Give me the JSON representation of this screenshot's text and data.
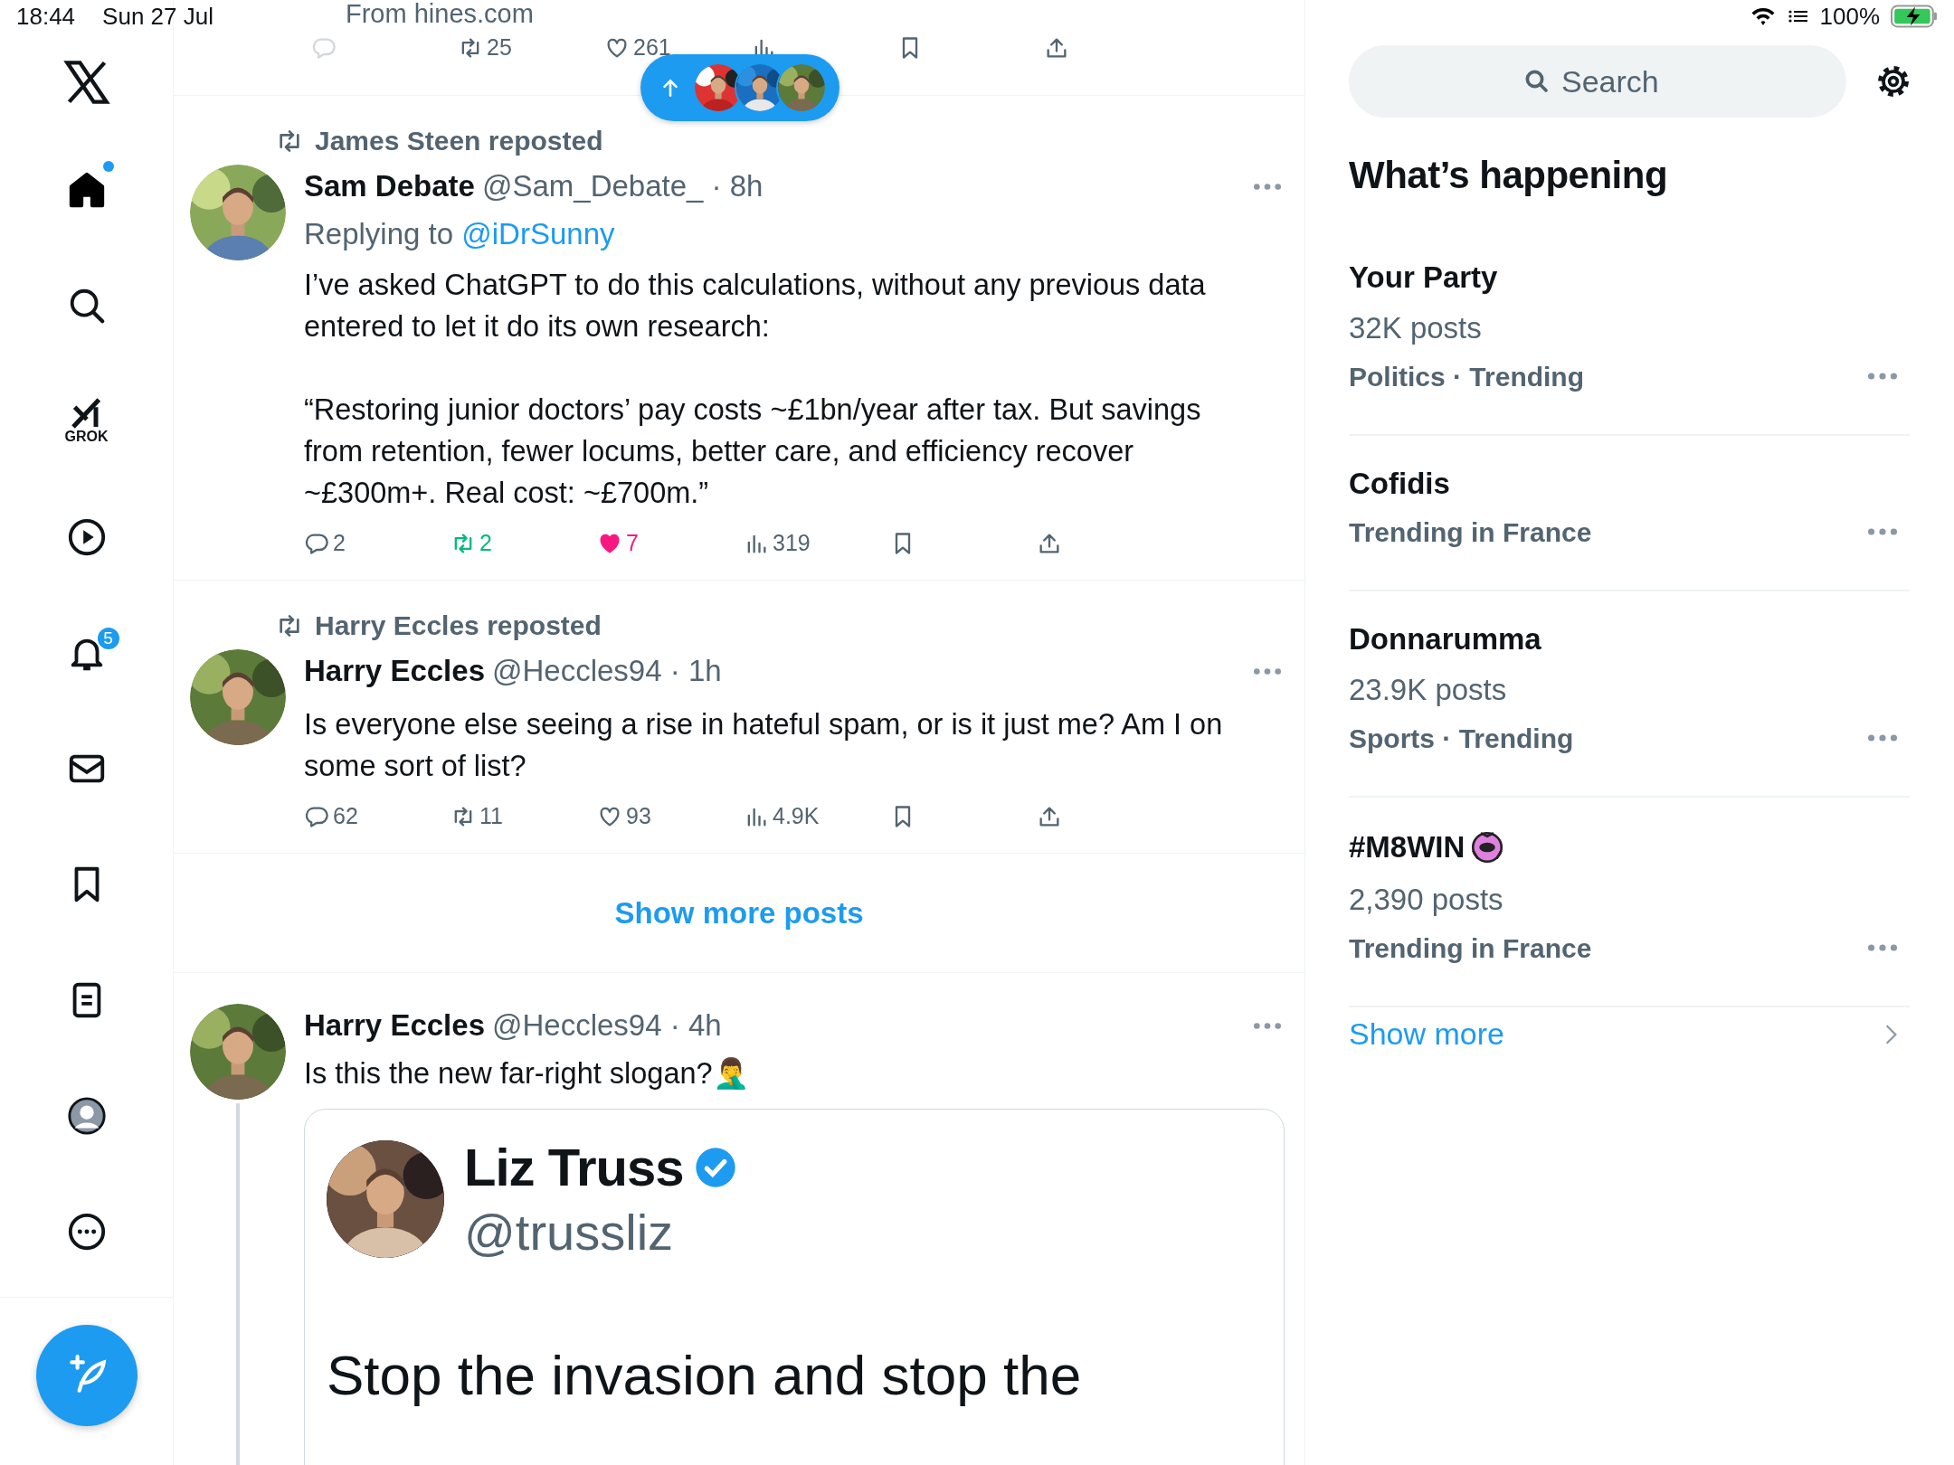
{
  "status_bar": {
    "time": "18:44",
    "date": "Sun 27 Jul",
    "battery": "100%"
  },
  "sidebar": {
    "items": [
      {
        "kind": "home",
        "selected": true,
        "dot": true
      },
      {
        "kind": "search",
        "selected": false,
        "dot": false
      },
      {
        "kind": "grok",
        "label": "GROK",
        "selected": false,
        "dot": false
      },
      {
        "kind": "video",
        "selected": false,
        "dot": false
      },
      {
        "kind": "notifications",
        "badge": "5",
        "selected": false,
        "dot": false
      },
      {
        "kind": "messages",
        "selected": false,
        "dot": false
      },
      {
        "kind": "bookmarks",
        "selected": false,
        "dot": false
      },
      {
        "kind": "lists",
        "selected": false,
        "dot": false
      },
      {
        "kind": "profile",
        "selected": false,
        "dot": false
      },
      {
        "kind": "more",
        "selected": false,
        "dot": false
      }
    ]
  },
  "top_post": {
    "source": "From hines.com",
    "stats": [
      {
        "kind": "reply",
        "active": false
      },
      {
        "kind": "repost",
        "count": "25",
        "active": false
      },
      {
        "kind": "like",
        "count": "261",
        "active": false
      },
      {
        "kind": "views",
        "active": false
      },
      {
        "kind": "bookmark",
        "active": false
      },
      {
        "kind": "share",
        "active": false
      }
    ]
  },
  "posts": [
    {
      "reposted_by": "James Steen reposted",
      "name": "Sam Debate",
      "handle_time": "@Sam_Debate_ · 8h",
      "replying_to": {
        "label": "Replying to",
        "handle": "@iDrSunny"
      },
      "text": [
        "I’ve asked ChatGPT to do this calculations, without any previous data entered to let it do its own research:",
        "“Restoring junior doctors’ pay costs ~£1bn/year after tax. But savings from retention, fewer locums, better care, and efficiency recover ~£300m+. Real cost: ~£700m.”"
      ],
      "stats": [
        {
          "kind": "reply",
          "count": "2",
          "active": false
        },
        {
          "kind": "repost",
          "count": "2",
          "active": true
        },
        {
          "kind": "like",
          "count": "7",
          "active": true
        },
        {
          "kind": "views",
          "count": "319",
          "active": false
        },
        {
          "kind": "bookmark",
          "active": false
        },
        {
          "kind": "share",
          "active": false
        }
      ]
    },
    {
      "reposted_by": "Harry Eccles reposted",
      "name": "Harry Eccles",
      "handle_time": "@Heccles94 · 1h",
      "text": [
        "Is everyone else seeing a rise in hateful spam, or is it just me? Am I on some sort of list?"
      ],
      "stats": [
        {
          "kind": "reply",
          "count": "62",
          "active": false
        },
        {
          "kind": "repost",
          "count": "11",
          "active": false
        },
        {
          "kind": "like",
          "count": "93",
          "active": false
        },
        {
          "kind": "views",
          "count": "4.9K",
          "active": false
        },
        {
          "kind": "bookmark",
          "active": false
        },
        {
          "kind": "share",
          "active": false
        }
      ]
    }
  ],
  "show_more_posts": "Show more posts",
  "thread_post": {
    "name": "Harry Eccles",
    "handle_time": "@Heccles94 · 4h",
    "text": "Is this the new far-right slogan?🤦‍♂️",
    "embedded_screenshot": {
      "name": "Liz Truss",
      "verified": true,
      "handle": "@trussliz",
      "text": "Stop the invasion and stop the"
    }
  },
  "search": {
    "placeholder": "Search"
  },
  "trends": {
    "title": "What’s happening",
    "items": [
      {
        "kind": "topic",
        "title": "Your Party",
        "posts": "32K posts",
        "meta": "Politics · Trending"
      },
      {
        "kind": "topic",
        "title": "Cofidis",
        "meta": "Trending in France"
      },
      {
        "kind": "topic",
        "title": "Donnarumma",
        "posts": "23.9K posts",
        "meta": "Sports · Trending"
      },
      {
        "kind": "badged_hashtag",
        "title": "#M8WIN",
        "posts": "2,390 posts",
        "meta": "Trending in France"
      }
    ],
    "show_more": "Show more"
  }
}
